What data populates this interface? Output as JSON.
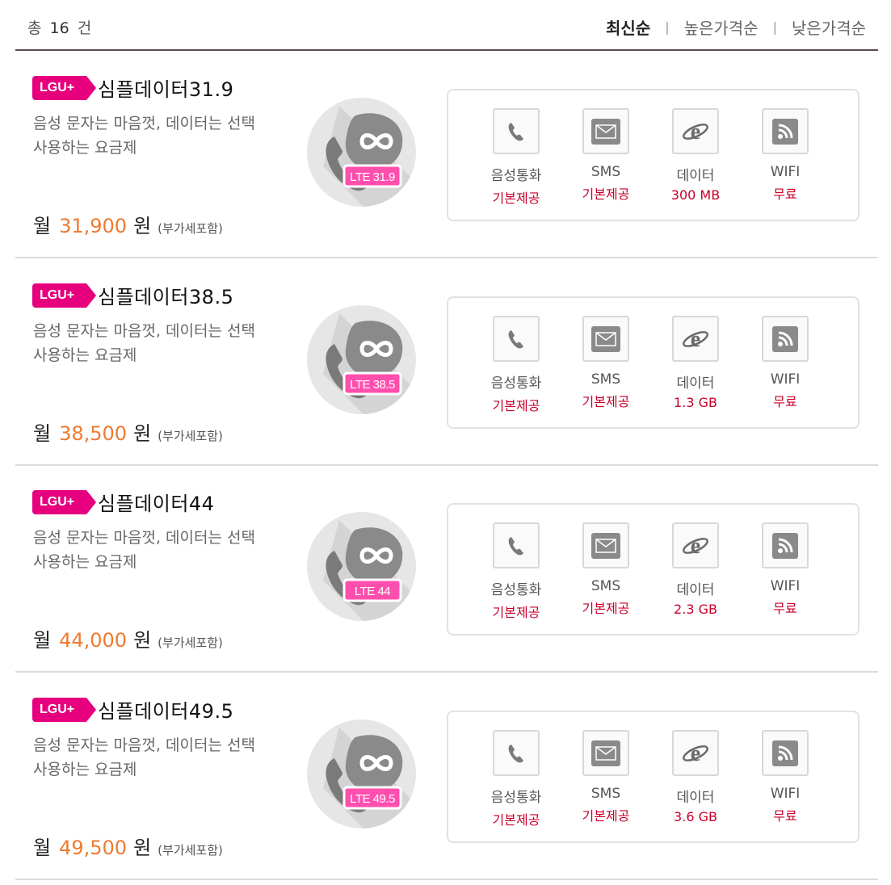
{
  "header": {
    "total_prefix": "총",
    "total_count": "16",
    "total_suffix": "건",
    "sort_options": [
      "최신순",
      "높은가격순",
      "낮은가격순"
    ],
    "sort_separator": "|"
  },
  "plans": [
    {
      "carrier": "LGU+",
      "name": "심플데이터31.9",
      "desc_line1": "음성 문자는 마음껏, 데이터는 선택",
      "desc_line2": "사용하는 요금제",
      "price_prefix": "월",
      "price": "31,900",
      "price_unit": "원",
      "tax_note": "(부가세포함)",
      "lte_label": "LTE 31.9",
      "features": [
        {
          "label": "음성통화",
          "value": "기본제공",
          "icon": "phone-icon"
        },
        {
          "label": "SMS",
          "value": "기본제공",
          "icon": "envelope-icon"
        },
        {
          "label": "데이터",
          "value": "300 MB",
          "icon": "browser-e-icon"
        },
        {
          "label": "WIFI",
          "value": "무료",
          "icon": "rss-icon"
        }
      ]
    },
    {
      "carrier": "LGU+",
      "name": "심플데이터38.5",
      "desc_line1": "음성 문자는 마음껏, 데이터는 선택",
      "desc_line2": "사용하는 요금제",
      "price_prefix": "월",
      "price": "38,500",
      "price_unit": "원",
      "tax_note": "(부가세포함)",
      "lte_label": "LTE 38.5",
      "features": [
        {
          "label": "음성통화",
          "value": "기본제공",
          "icon": "phone-icon"
        },
        {
          "label": "SMS",
          "value": "기본제공",
          "icon": "envelope-icon"
        },
        {
          "label": "데이터",
          "value": "1.3 GB",
          "icon": "browser-e-icon"
        },
        {
          "label": "WIFI",
          "value": "무료",
          "icon": "rss-icon"
        }
      ]
    },
    {
      "carrier": "LGU+",
      "name": "심플데이터44",
      "desc_line1": "음성 문자는 마음껏, 데이터는 선택",
      "desc_line2": "사용하는 요금제",
      "price_prefix": "월",
      "price": "44,000",
      "price_unit": "원",
      "tax_note": "(부가세포함)",
      "lte_label": "LTE 44",
      "features": [
        {
          "label": "음성통화",
          "value": "기본제공",
          "icon": "phone-icon"
        },
        {
          "label": "SMS",
          "value": "기본제공",
          "icon": "envelope-icon"
        },
        {
          "label": "데이터",
          "value": "2.3 GB",
          "icon": "browser-e-icon"
        },
        {
          "label": "WIFI",
          "value": "무료",
          "icon": "rss-icon"
        }
      ]
    },
    {
      "carrier": "LGU+",
      "name": "심플데이터49.5",
      "desc_line1": "음성 문자는 마음껏, 데이터는 선택",
      "desc_line2": "사용하는 요금제",
      "price_prefix": "월",
      "price": "49,500",
      "price_unit": "원",
      "tax_note": "(부가세포함)",
      "lte_label": "LTE 49.5",
      "features": [
        {
          "label": "음성통화",
          "value": "기본제공",
          "icon": "phone-icon"
        },
        {
          "label": "SMS",
          "value": "기본제공",
          "icon": "envelope-icon"
        },
        {
          "label": "데이터",
          "value": "3.6 GB",
          "icon": "browser-e-icon"
        },
        {
          "label": "WIFI",
          "value": "무료",
          "icon": "rss-icon"
        }
      ]
    }
  ],
  "colors": {
    "carrier_badge": "#e6007e",
    "price": "#ee7a2f",
    "feature_value": "#c8002a",
    "lte_tag": "#ff4fae"
  }
}
